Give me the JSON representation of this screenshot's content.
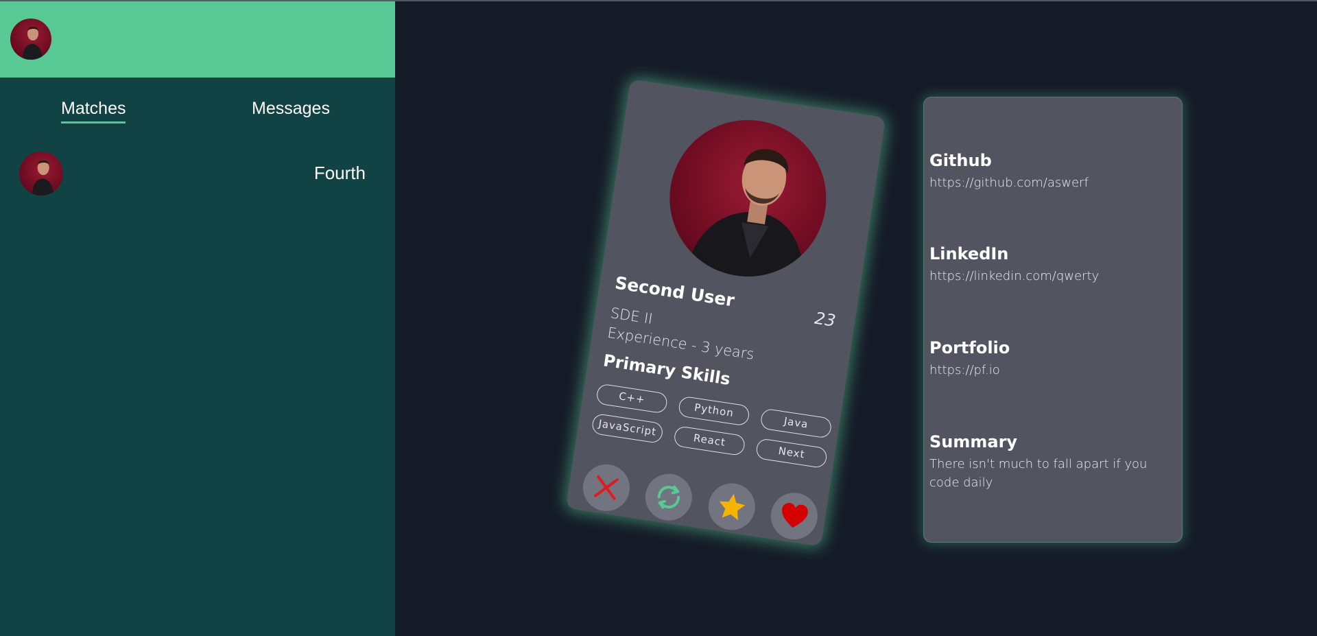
{
  "sidebar": {
    "tabs": [
      {
        "label": "Matches",
        "active": true
      },
      {
        "label": "Messages",
        "active": false
      }
    ],
    "matches": [
      {
        "name": "Fourth"
      }
    ]
  },
  "card": {
    "name": "Second User",
    "age": "23",
    "role": "SDE II",
    "experience": "Experience - 3 years",
    "skills_title": "Primary Skills",
    "skills": [
      "C++",
      "Python",
      "Java",
      "JavaScript",
      "React",
      "Next"
    ],
    "actions": [
      "close-icon",
      "refresh-icon",
      "star-icon",
      "heart-icon"
    ]
  },
  "info": {
    "github": {
      "title": "Github",
      "value": "https://github.com/aswerf"
    },
    "linkedin": {
      "title": "LinkedIn",
      "value": "https://linkedin.com/qwerty"
    },
    "portfolio": {
      "title": "Portfolio",
      "value": "https://pf.io"
    },
    "summary": {
      "title": "Summary",
      "value": "There isn't much to fall apart if you code daily"
    }
  },
  "colors": {
    "background": "#151b27",
    "sidebar": "#114244",
    "accent": "#58c994",
    "card": "#525560",
    "reject": "#e01b1b",
    "star": "#f6b300",
    "heart": "#d40000"
  }
}
